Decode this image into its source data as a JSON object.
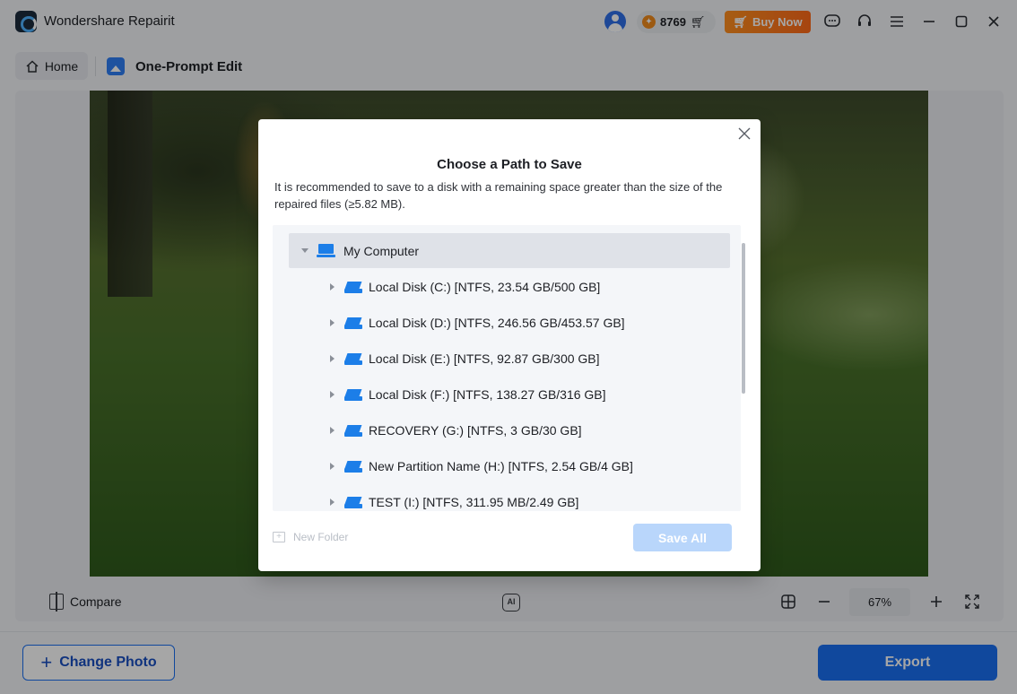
{
  "app": {
    "title": "Wondershare Repairit"
  },
  "header": {
    "credits": "8769",
    "buy_label": "Buy Now"
  },
  "nav": {
    "home_label": "Home",
    "feature_title": "One-Prompt Edit"
  },
  "toolbar": {
    "compare_label": "Compare",
    "zoom_value": "67%"
  },
  "footer": {
    "change_photo_label": "Change Photo",
    "export_label": "Export"
  },
  "dialog": {
    "title": "Choose a Path to Save",
    "description": "It is recommended to save to a disk with a remaining space greater than the size of the repaired files (≥5.82 MB).",
    "root_label": "My Computer",
    "disks": [
      {
        "label": "Local Disk (C:) [NTFS, 23.54 GB/500 GB]"
      },
      {
        "label": "Local Disk (D:) [NTFS, 246.56 GB/453.57 GB]"
      },
      {
        "label": "Local Disk (E:) [NTFS, 92.87 GB/300 GB]"
      },
      {
        "label": "Local Disk (F:) [NTFS, 138.27 GB/316 GB]"
      },
      {
        "label": "RECOVERY (G:) [NTFS, 3 GB/30 GB]"
      },
      {
        "label": "New Partition Name (H:) [NTFS, 2.54 GB/4 GB]"
      },
      {
        "label": "TEST (I:) [NTFS, 311.95 MB/2.49 GB]"
      }
    ],
    "new_folder_label": "New Folder",
    "save_all_label": "Save All"
  },
  "colors": {
    "accent": "#1a6ff2",
    "buy_now": "#ff7a1a",
    "disk_icon": "#1c7ee8",
    "save_all_disabled": "#b9d6fb"
  },
  "icons": [
    "app-logo-icon",
    "avatar-icon",
    "coin-icon",
    "cart-icon",
    "message-icon",
    "headset-icon",
    "menu-icon",
    "minimize-icon",
    "maximize-icon",
    "close-icon",
    "home-icon",
    "image-edit-icon",
    "compare-icon",
    "ai-enhance-icon",
    "grid-icon",
    "zoom-out-icon",
    "zoom-in-icon",
    "fit-screen-icon",
    "plus-icon",
    "computer-icon",
    "disk-icon",
    "new-folder-icon",
    "chevron-down-icon",
    "chevron-right-icon"
  ]
}
